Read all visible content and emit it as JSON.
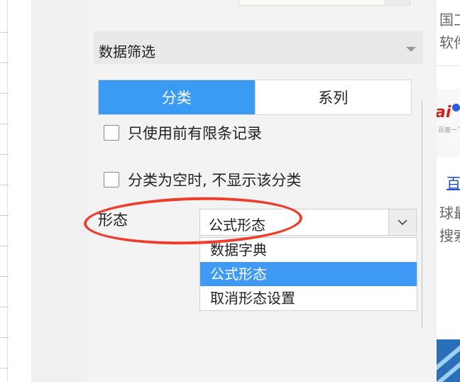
{
  "panel": {
    "section_title": "数据筛选",
    "tabs": [
      {
        "label": "分类",
        "active": true
      },
      {
        "label": "系列",
        "active": false
      }
    ],
    "options": [
      {
        "label": "只使用前有限条记录",
        "checked": false
      },
      {
        "label": "分类为空时, 不显示该分类",
        "checked": false
      }
    ],
    "form_label": "形态",
    "select": {
      "value": "公式形态",
      "options": [
        "数据字典",
        "公式形态",
        "取消形态设置"
      ],
      "selected_index": 1
    }
  },
  "right_page": {
    "line1": "国⼯",
    "line2": "软件",
    "logo_text": "ai",
    "logo_small": "百度一下",
    "link": "百",
    "line3": "球最",
    "line4": "搜索"
  },
  "colors": {
    "accent": "#3a9bf3",
    "annotation": "#ee3d2b",
    "panel_bg": "#f3f3f4"
  }
}
